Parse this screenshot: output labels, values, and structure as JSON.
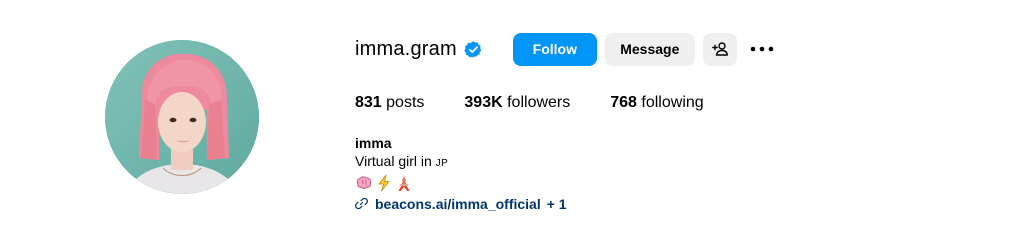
{
  "profile": {
    "username": "imma.gram",
    "verified": true,
    "avatar_icon": "profile-photo-pink-bob-hair",
    "accent_color": "#0095f6"
  },
  "actions": {
    "follow_label": "Follow",
    "message_label": "Message",
    "add_user_icon": "add-user-icon",
    "more_icon": "more-options-icon"
  },
  "stats": {
    "posts_count": "831",
    "posts_label": "posts",
    "followers_count": "393K",
    "followers_label": "followers",
    "following_count": "768",
    "following_label": "following"
  },
  "bio": {
    "name": "imma",
    "line1": "Virtual girl in",
    "country": "JP",
    "emojis": [
      "brain-icon",
      "lightning-icon",
      "tokyo-tower-icon"
    ],
    "link_text": "beacons.ai/imma_official",
    "link_extra": "+ 1"
  }
}
